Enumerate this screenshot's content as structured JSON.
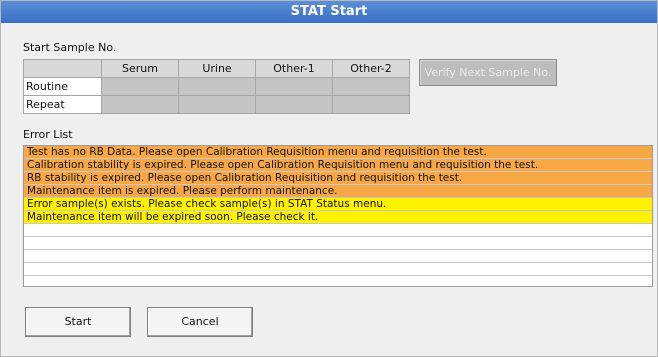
{
  "window": {
    "title": "STAT Start"
  },
  "start_sample": {
    "label": "Start Sample No.",
    "columns": [
      "Serum",
      "Urine",
      "Other-1",
      "Other-2"
    ],
    "rows": [
      {
        "label": "Routine",
        "values": [
          "",
          "",
          "",
          ""
        ]
      },
      {
        "label": "Repeat",
        "values": [
          "",
          "",
          "",
          ""
        ]
      }
    ],
    "verify_button": "Verify Next Sample No."
  },
  "error_list": {
    "label": "Error List",
    "items": [
      {
        "text": "Test has no RB Data. Please open Calibration Requisition menu and requisition the test.",
        "level": "error",
        "color": "#f7a844"
      },
      {
        "text": "Calibration stability is expired. Please open Calibration Requisition menu and requisition the test.",
        "level": "error",
        "color": "#f7a844"
      },
      {
        "text": "RB stability is expired. Please open Calibration Requisition and requisition the test.",
        "level": "error",
        "color": "#f7a844"
      },
      {
        "text": "Maintenance item is expired. Please perform maintenance.",
        "level": "error",
        "color": "#f7a844"
      },
      {
        "text": "Error sample(s) exists. Please check sample(s) in STAT Status menu.",
        "level": "warning",
        "color": "#fff200"
      },
      {
        "text": "Maintenance item will be expired soon. Please check it.",
        "level": "warning",
        "color": "#fff200"
      },
      {
        "text": "",
        "level": "empty"
      },
      {
        "text": "",
        "level": "empty"
      },
      {
        "text": "",
        "level": "empty"
      },
      {
        "text": "",
        "level": "empty"
      }
    ]
  },
  "footer": {
    "start_button": "Start",
    "cancel_button": "Cancel"
  }
}
